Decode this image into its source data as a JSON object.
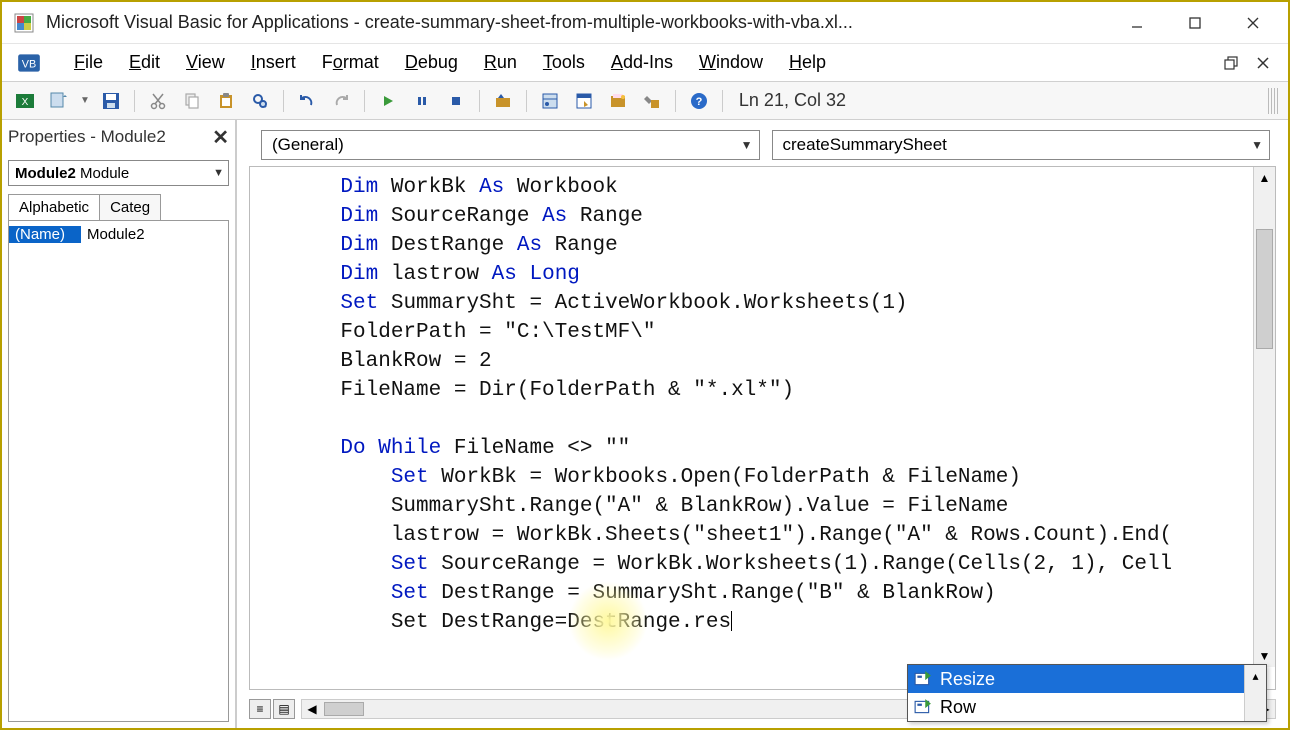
{
  "title_bar": {
    "title": "Microsoft Visual Basic for Applications - create-summary-sheet-from-multiple-workbooks-with-vba.xl..."
  },
  "menu": {
    "items": [
      {
        "u": "F",
        "rest": "ile"
      },
      {
        "u": "E",
        "rest": "dit"
      },
      {
        "u": "V",
        "rest": "iew"
      },
      {
        "u": "I",
        "rest": "nsert"
      },
      {
        "u": "F",
        "pre": "",
        "mid": "o",
        "rest": "rmat",
        "full": "Format"
      },
      {
        "u": "D",
        "rest": "ebug"
      },
      {
        "u": "R",
        "rest": "un"
      },
      {
        "u": "T",
        "rest": "ools"
      },
      {
        "u": "A",
        "rest": "dd-Ins"
      },
      {
        "u": "W",
        "rest": "indow"
      },
      {
        "u": "H",
        "rest": "elp"
      }
    ]
  },
  "toolbar": {
    "status": "Ln 21, Col 32"
  },
  "properties": {
    "title": "Properties - Module2",
    "combo_value": "Module2 Module",
    "tabs": [
      "Alphabetic",
      "Categ"
    ],
    "rows": [
      {
        "key": "(Name)",
        "value": "Module2"
      }
    ]
  },
  "code_combos": {
    "left": "(General)",
    "right": "createSummarySheet"
  },
  "code_lines": [
    {
      "indent": 1,
      "parts": [
        {
          "t": "Dim",
          "k": 1
        },
        {
          "t": " WorkBk "
        },
        {
          "t": "As",
          "k": 1
        },
        {
          "t": " Workbook"
        }
      ]
    },
    {
      "indent": 1,
      "parts": [
        {
          "t": "Dim",
          "k": 1
        },
        {
          "t": " SourceRange "
        },
        {
          "t": "As",
          "k": 1
        },
        {
          "t": " Range"
        }
      ]
    },
    {
      "indent": 1,
      "parts": [
        {
          "t": "Dim",
          "k": 1
        },
        {
          "t": " DestRange "
        },
        {
          "t": "As",
          "k": 1
        },
        {
          "t": " Range"
        }
      ]
    },
    {
      "indent": 1,
      "parts": [
        {
          "t": "Dim",
          "k": 1
        },
        {
          "t": " lastrow "
        },
        {
          "t": "As",
          "k": 1
        },
        {
          "t": " "
        },
        {
          "t": "Long",
          "k": 1
        }
      ]
    },
    {
      "indent": 1,
      "parts": [
        {
          "t": "Set",
          "k": 1
        },
        {
          "t": " SummarySht = ActiveWorkbook.Worksheets(1)"
        }
      ]
    },
    {
      "indent": 1,
      "parts": [
        {
          "t": "FolderPath = \"C:\\TestMF\\\""
        }
      ]
    },
    {
      "indent": 1,
      "parts": [
        {
          "t": "BlankRow = 2"
        }
      ]
    },
    {
      "indent": 1,
      "parts": [
        {
          "t": "FileName = Dir(FolderPath & \"*.xl*\")"
        }
      ]
    },
    {
      "indent": 1,
      "parts": [
        {
          "t": ""
        }
      ]
    },
    {
      "indent": 1,
      "parts": [
        {
          "t": "Do While",
          "k": 1
        },
        {
          "t": " FileName <> \"\""
        }
      ]
    },
    {
      "indent": 2,
      "parts": [
        {
          "t": "Set",
          "k": 1
        },
        {
          "t": " WorkBk = Workbooks.Open(FolderPath & FileName)"
        }
      ]
    },
    {
      "indent": 2,
      "parts": [
        {
          "t": "SummarySht.Range(\"A\" & BlankRow).Value = FileName"
        }
      ]
    },
    {
      "indent": 2,
      "parts": [
        {
          "t": "lastrow = WorkBk.Sheets(\"sheet1\").Range(\"A\" & Rows.Count).End("
        }
      ]
    },
    {
      "indent": 2,
      "parts": [
        {
          "t": "Set",
          "k": 1
        },
        {
          "t": " SourceRange = WorkBk.Worksheets(1).Range(Cells(2, 1), Cell"
        }
      ]
    },
    {
      "indent": 2,
      "parts": [
        {
          "t": "Set",
          "k": 1
        },
        {
          "t": " DestRange = SummarySht.Range(\"B\" & BlankRow)"
        }
      ]
    },
    {
      "indent": 2,
      "parts": [
        {
          "t": "Set DestRange=DestRange.res"
        }
      ],
      "caret": true
    }
  ],
  "intellisense": {
    "items": [
      {
        "label": "Resize",
        "selected": true
      },
      {
        "label": "Row",
        "selected": false
      }
    ]
  }
}
